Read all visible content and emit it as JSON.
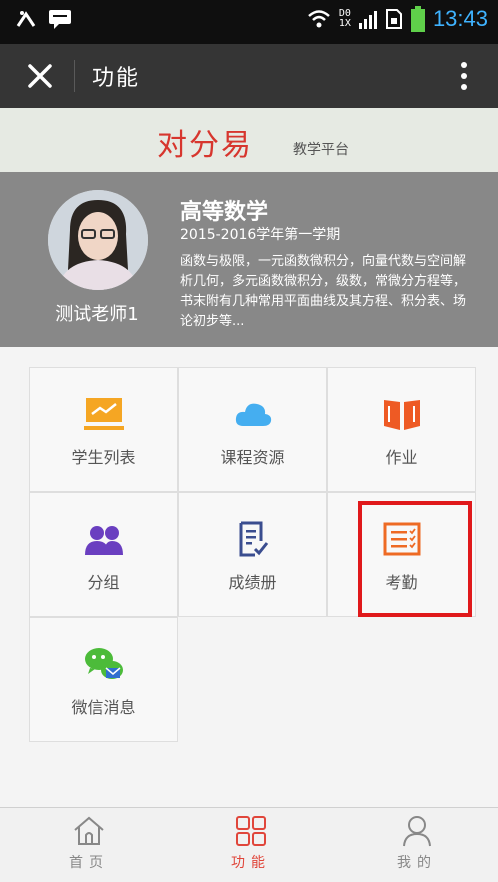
{
  "status_bar": {
    "net_top": "D0",
    "net_bottom": "1X",
    "time": "13:43"
  },
  "titlebar": {
    "title": "功能"
  },
  "brand": {
    "logo": "对分易",
    "subtitle": "教学平台",
    "color": "#d7362e"
  },
  "course": {
    "teacher": "测试老师1",
    "title": "高等数学",
    "term": "2015-2016学年第一学期",
    "description": "函数与极限，一元函数微积分，向量代数与空间解析几何，多元函数微积分，级数，常微分方程等，书末附有几种常用平面曲线及其方程、积分表、场论初步等..."
  },
  "functions": [
    {
      "label": "学生列表",
      "icon": "chart-icon",
      "color": "#f5a623"
    },
    {
      "label": "课程资源",
      "icon": "cloud-icon",
      "color": "#45aef0"
    },
    {
      "label": "作业",
      "icon": "book-icon",
      "color": "#ee5a24"
    },
    {
      "label": "分组",
      "icon": "group-icon",
      "color": "#6a3fc0"
    },
    {
      "label": "成绩册",
      "icon": "gradebook-icon",
      "color": "#3a4d8f"
    },
    {
      "label": "考勤",
      "icon": "attendance-icon",
      "color": "#ee6a24"
    },
    {
      "label": "微信消息",
      "icon": "wechat-icon",
      "color": "#4cbb3a"
    }
  ],
  "tabbar": {
    "items": [
      {
        "label": "首页",
        "icon": "home-icon"
      },
      {
        "label": "功能",
        "icon": "grid-icon",
        "active": true
      },
      {
        "label": "我的",
        "icon": "user-icon"
      }
    ],
    "active_color": "#e0463b"
  }
}
